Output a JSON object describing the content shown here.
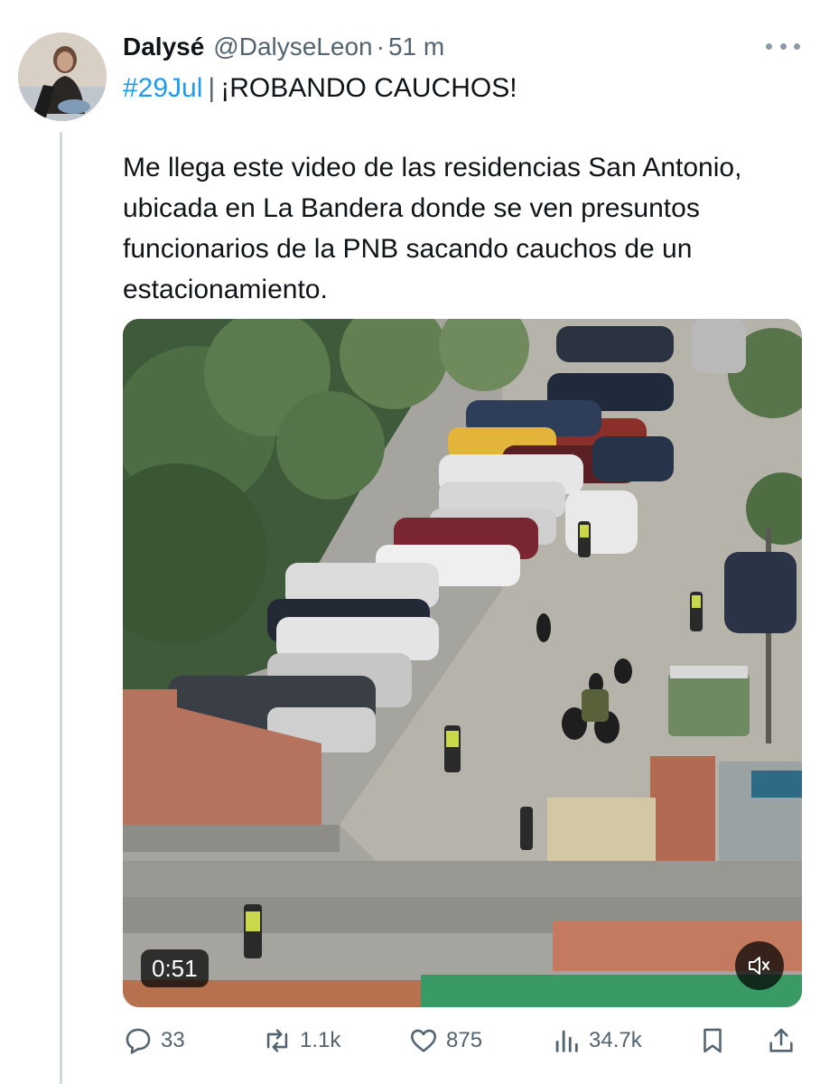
{
  "tweet": {
    "author_name": "Dalysé",
    "author_handle": "@DalyseLeon",
    "separator": "·",
    "time_ago": "51 m",
    "hashtag": "#29Jul",
    "title_separator": "|",
    "headline": "¡ROBANDO CAUCHOS!",
    "body": "Me llega este video de las residencias San Antonio, ubicada en La Bandera donde se ven presuntos funcionarios de la PNB sacando cauchos de un estacionamiento."
  },
  "media": {
    "type": "video",
    "duration": "0:51",
    "muted": true,
    "mute_icon": "speaker-muted-icon"
  },
  "actions": {
    "replies": {
      "icon": "reply-icon",
      "count": "33"
    },
    "reposts": {
      "icon": "repost-icon",
      "count": "1.1k"
    },
    "likes": {
      "icon": "heart-icon",
      "count": "875"
    },
    "views": {
      "icon": "views-icon",
      "count": "34.7k"
    },
    "bookmark": {
      "icon": "bookmark-icon"
    },
    "share": {
      "icon": "share-icon"
    }
  },
  "colors": {
    "link": "#1d9bf0",
    "secondary_text": "#536471",
    "primary_text": "#0f1419",
    "thread_line": "#cfd9de"
  }
}
